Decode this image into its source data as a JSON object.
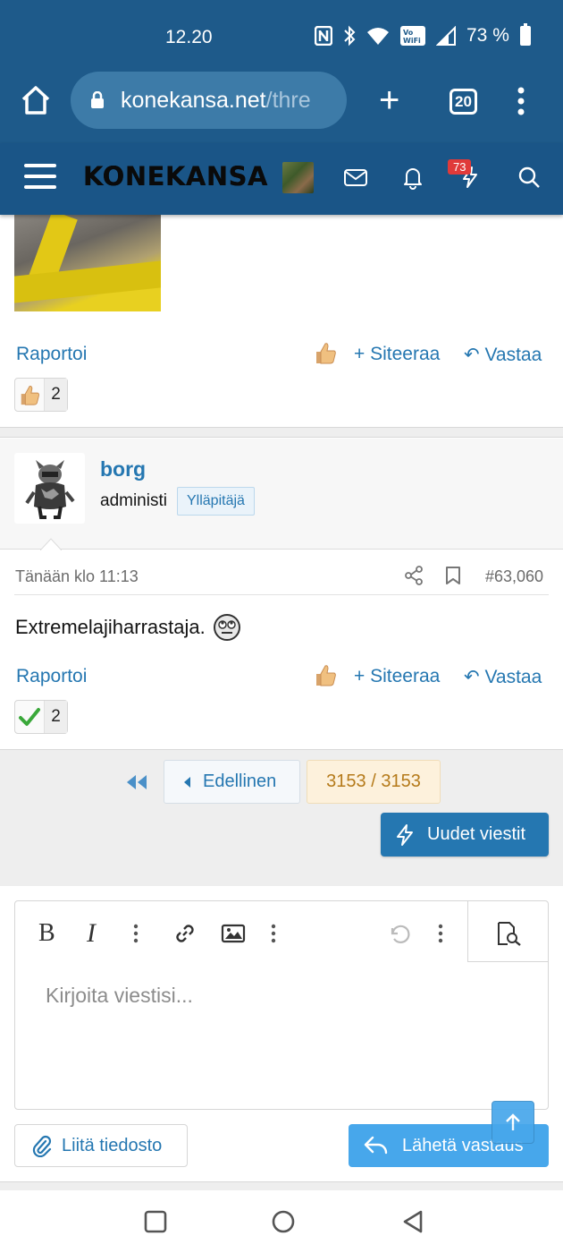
{
  "status_bar": {
    "time": "12.20",
    "battery_percent": "73 %",
    "icons": [
      "nfc-icon",
      "bluetooth-icon",
      "wifi-icon",
      "vowifi-icon",
      "signal-icon",
      "battery-icon"
    ]
  },
  "browser": {
    "url_host": "konekansa.net",
    "url_path": "/thre",
    "tab_count": "20"
  },
  "site": {
    "logo": "KONEKANSA",
    "alerts_count": "73"
  },
  "post_prev": {
    "actions": {
      "report": "Raportoi",
      "quote": "Siteeraa",
      "reply": "Vastaa"
    },
    "reaction": {
      "emoji": "thumbs-up",
      "count": "2"
    }
  },
  "post": {
    "username": "borg",
    "user_title": "administi",
    "staff_badge": "Ylläpitäjä",
    "date": "Tänään klo 11:13",
    "post_number": "#63,060",
    "body": "Extremelajiharrastaja.",
    "actions": {
      "report": "Raportoi",
      "quote": "Siteeraa",
      "reply": "Vastaa"
    },
    "reaction": {
      "emoji": "check-mark",
      "count": "2"
    }
  },
  "pagination": {
    "prev_label": "Edellinen",
    "page_indicator": "3153 / 3153",
    "new_posts_label": "Uudet viestit"
  },
  "editor": {
    "placeholder": "Kirjoita viestisi...",
    "attach_label": "Liitä tiedosto",
    "submit_label": "Lähetä vastaus"
  },
  "colors": {
    "chrome": "#1e5a8a",
    "header": "#1a5587",
    "link": "#2577b1",
    "submit": "#47a7eb",
    "page_badge_bg": "#fdf1dc"
  }
}
